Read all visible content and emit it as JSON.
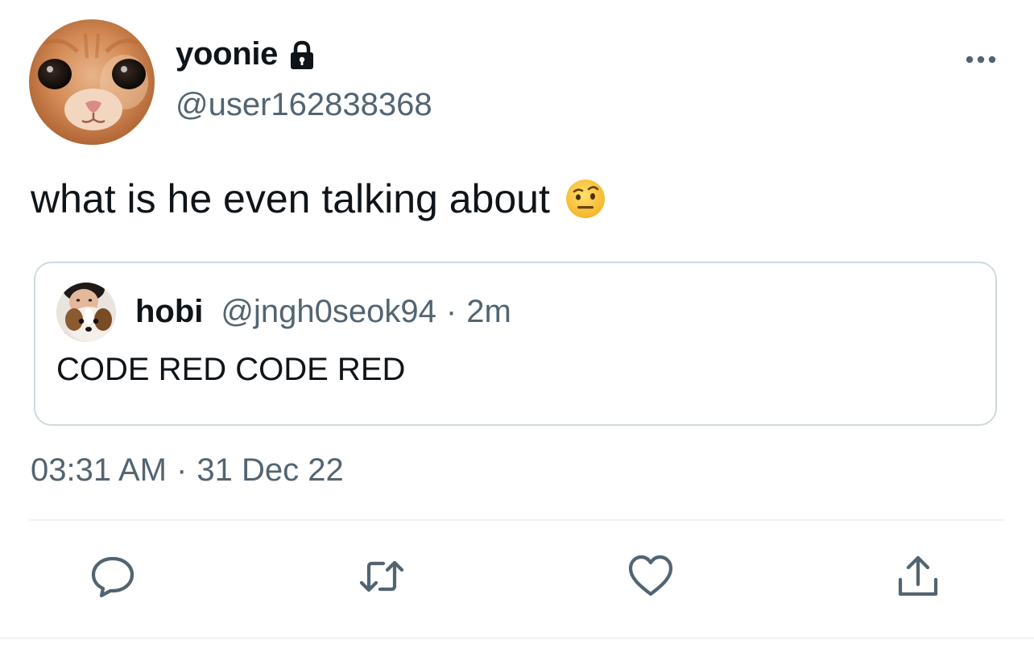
{
  "author": {
    "display_name": "yoonie",
    "handle": "@user162838368",
    "protected": true,
    "avatar_icon": "cat-avatar"
  },
  "tweet": {
    "text": "what is he even talking about",
    "emoji": "face-with-raised-eyebrow"
  },
  "quote": {
    "display_name": "hobi",
    "handle": "@jngh0seok94",
    "separator": "·",
    "time": "2m",
    "text": "CODE RED CODE RED",
    "avatar_icon": "person-with-dog-avatar"
  },
  "meta": {
    "time": "03:31 AM",
    "separator": "·",
    "date": "31 Dec 22"
  },
  "actions": {
    "reply_icon": "reply-icon",
    "retweet_icon": "retweet-icon",
    "like_icon": "heart-icon",
    "share_icon": "share-icon"
  },
  "colors": {
    "text_primary": "#0f1419",
    "text_secondary": "#536471",
    "border": "#cfd9de",
    "divider": "#eff3f4"
  }
}
